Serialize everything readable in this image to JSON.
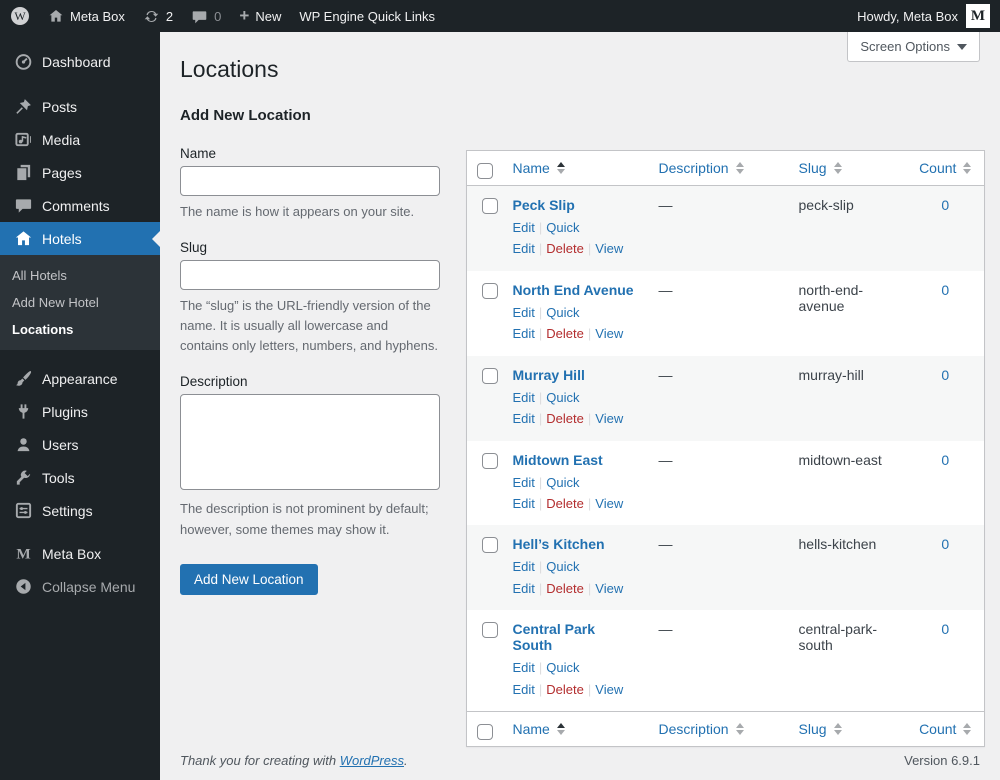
{
  "admin_bar": {
    "site_name": "Meta Box",
    "update_count": "2",
    "comment_count": "0",
    "new_label": "New",
    "quick_links_label": "WP Engine Quick Links",
    "howdy": "Howdy, Meta Box",
    "avatar_letter": "M"
  },
  "sidebar": {
    "items": [
      {
        "label": "Dashboard"
      },
      {
        "label": "Posts"
      },
      {
        "label": "Media"
      },
      {
        "label": "Pages"
      },
      {
        "label": "Comments"
      },
      {
        "label": "Hotels"
      },
      {
        "label": "Appearance"
      },
      {
        "label": "Plugins"
      },
      {
        "label": "Users"
      },
      {
        "label": "Tools"
      },
      {
        "label": "Settings"
      },
      {
        "label": "Meta Box"
      },
      {
        "label": "Collapse Menu"
      }
    ],
    "submenu": [
      {
        "label": "All Hotels"
      },
      {
        "label": "Add New Hotel"
      },
      {
        "label": "Locations"
      }
    ]
  },
  "header": {
    "screen_options_label": "Screen Options"
  },
  "page": {
    "title": "Locations"
  },
  "form": {
    "heading": "Add New Location",
    "name_label": "Name",
    "name_value": "",
    "name_help": "The name is how it appears on your site.",
    "slug_label": "Slug",
    "slug_value": "",
    "slug_help": "The “slug” is the URL-friendly version of the name. It is usually all lowercase and contains only letters, numbers, and hyphens.",
    "description_label": "Description",
    "description_value": "",
    "description_help": "The description is not prominent by default; however, some themes may show it.",
    "submit_label": "Add New Location"
  },
  "table": {
    "columns": [
      "Name",
      "Description",
      "Slug",
      "Count"
    ],
    "row_actions": [
      "Edit",
      "Quick Edit",
      "Delete",
      "View"
    ],
    "action_separator": "|",
    "rows": [
      {
        "name": "Peck Slip",
        "description": "—",
        "slug": "peck-slip",
        "count": "0"
      },
      {
        "name": "North End Avenue",
        "description": "—",
        "slug": "north-end-avenue",
        "count": "0"
      },
      {
        "name": "Murray Hill",
        "description": "—",
        "slug": "murray-hill",
        "count": "0"
      },
      {
        "name": "Midtown East",
        "description": "—",
        "slug": "midtown-east",
        "count": "0"
      },
      {
        "name": "Hell’s Kitchen",
        "description": "—",
        "slug": "hells-kitchen",
        "count": "0"
      },
      {
        "name": "Central Park South",
        "description": "—",
        "slug": "central-park-south",
        "count": "0"
      }
    ]
  },
  "footer": {
    "thanks_prefix": "Thank you for creating with ",
    "wordpress_link": "WordPress",
    "thanks_suffix": ".",
    "version": "Version 6.9.1"
  },
  "colors": {
    "accent": "#2271b1",
    "delete_link": "#b32d2e",
    "admin_bar_bg": "#1d2327",
    "sidebar_bg": "#1d2327",
    "submenu_bg": "#2c3338",
    "content_bg": "#f0f0f1",
    "row_alt_bg": "#f6f7f7"
  }
}
